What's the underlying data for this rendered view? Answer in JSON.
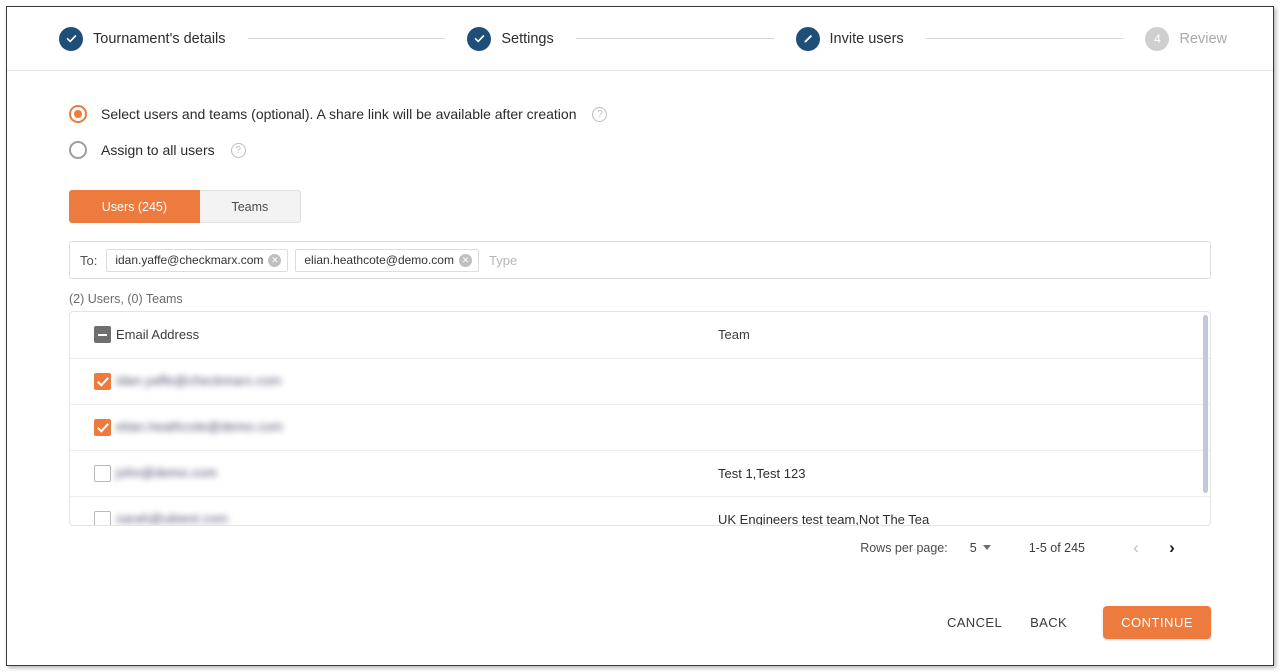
{
  "stepper": {
    "steps": [
      {
        "label": "Tournament's details",
        "state": "done",
        "icon": "check-icon",
        "num": "1"
      },
      {
        "label": "Settings",
        "state": "done",
        "icon": "check-icon",
        "num": "2"
      },
      {
        "label": "Invite users",
        "state": "current",
        "icon": "pencil-icon",
        "num": "3"
      },
      {
        "label": "Review",
        "state": "upcoming",
        "icon": "number",
        "num": "4"
      }
    ]
  },
  "options": {
    "select_users": {
      "label": "Select users and teams (optional). A share link will be available after creation",
      "selected": true,
      "help": "?"
    },
    "assign_all": {
      "label": "Assign to all users",
      "selected": false,
      "help": "?"
    }
  },
  "tabs": [
    {
      "label": "Users  (245)",
      "active": true
    },
    {
      "label": "Teams",
      "active": false
    }
  ],
  "recipients": {
    "to_label": "To:",
    "placeholder": "Type",
    "chips": [
      {
        "email": "idan.yaffe@checkmarx.com",
        "remove": "✕"
      },
      {
        "email": "elian.heathcote@demo.com",
        "remove": "✕"
      }
    ]
  },
  "selection_summary": "(2) Users, (0) Teams",
  "table": {
    "columns": [
      "Email Address",
      "Team"
    ],
    "header_checkbox_state": "indeterminate",
    "rows": [
      {
        "checked": true,
        "email": "idan.yaffe@checkmarx.com",
        "email_blurred": true,
        "team": ""
      },
      {
        "checked": true,
        "email": "elian.heathcote@demo.com",
        "email_blurred": true,
        "team": ""
      },
      {
        "checked": false,
        "email": "john@demo.com",
        "email_blurred": true,
        "team": "Test 1,Test 123"
      },
      {
        "checked": false,
        "email": "sarah@uktest.com",
        "email_blurred": true,
        "team": "UK Engineers test team,Not The Tea"
      }
    ]
  },
  "pagination": {
    "rows_per_page_label": "Rows per page:",
    "rows_per_page_value": "5",
    "range": "1-5 of 245",
    "prev_icon": "‹",
    "next_icon": "›"
  },
  "footer": {
    "cancel": "CANCEL",
    "back": "BACK",
    "continue": "CONTINUE"
  },
  "colors": {
    "accent_orange": "#ee7b3e",
    "step_navy": "#1f4e79",
    "step_grey": "#cfcfcf",
    "scrollbar": "#c3c7de"
  }
}
